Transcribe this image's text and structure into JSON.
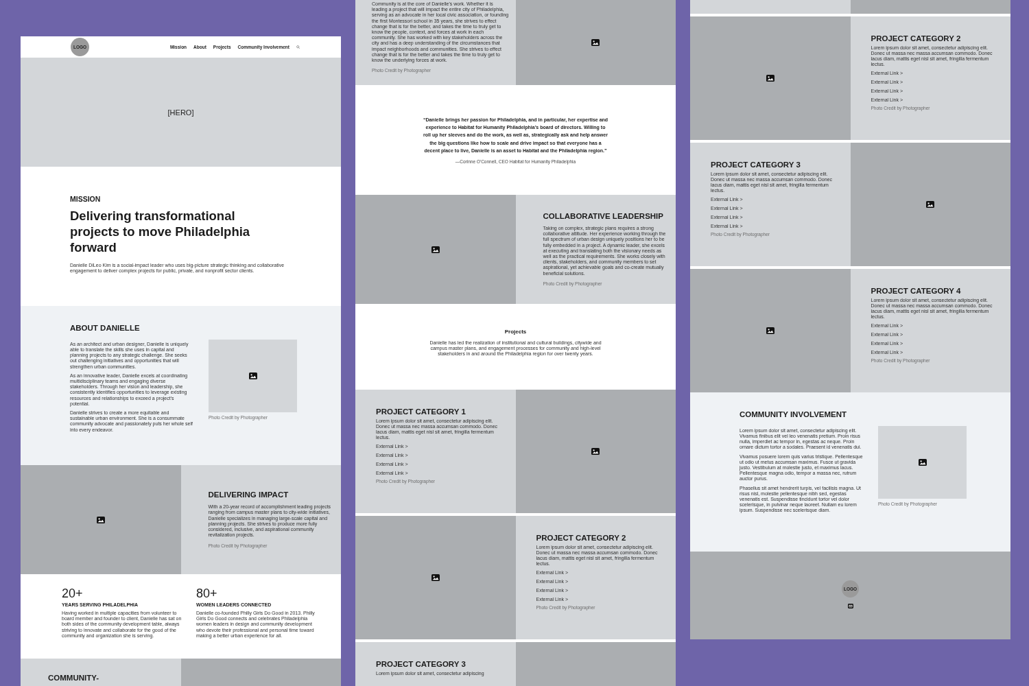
{
  "columns": [
    {
      "sections": [
        {
          "kind": "header",
          "logo": "LOGO",
          "nav": [
            "Mission",
            "About",
            "Projects",
            "Community Involvement"
          ]
        },
        {
          "kind": "hero",
          "label": "[HERO]"
        },
        {
          "kind": "mission",
          "eyebrow": "MISSION",
          "headline": "Delivering transformational projects to move Philadelphia forward",
          "body": "Danielle DiLeo Kim is a social-impact leader who uses big-picture strategic thinking and collaborative engagement to deliver complex projects for public, private, and nonprofit sector clients."
        },
        {
          "kind": "feature",
          "heading": "ABOUT DANIELLE",
          "paragraphs": [
            "As an architect and urban designer, Danielle is uniquely able to translate the skills she uses in capital and planning projects to any strategic challenge. She seeks out challenging initiatives and opportunities that will strengthen urban communities.",
            "As an innovative leader, Danielle excels at coordinating multidisciplinary teams and engaging diverse stakeholders. Through her vision and leadership, she consistently identifies opportunities to leverage existing resources and relationships to exceed a project's potential.",
            "Danielle strives to create a more equitable and sustainable urban environment. She is a consummate community advocate and passionately puts her whole self into every endeavor."
          ],
          "credit": "Photo Credit by Photographer"
        },
        {
          "kind": "split",
          "panels": [
            {
              "kind": "image",
              "icon": true
            },
            {
              "kind": "text",
              "heading": "DELIVERING IMPACT",
              "paragraphs": [
                "With a 20-year record of accomplishment leading projects ranging from campus master plans to city-wide initiatives, Danielle specializes in managing large-scale capital and planning projects. She strives to produce more fully considered, inclusive, and aspirational community revitalization projects."
              ],
              "credit": "Photo Credit by Photographer"
            }
          ]
        },
        {
          "kind": "stats",
          "items": [
            {
              "figure": "20+",
              "label": "YEARS SERVING PHILADELPHIA",
              "text": "Having worked in multiple capacities from volunteer to board member and founder to client, Danielle has sat on both sides of the community development table, always striving to innovate and collaborate for the good of the community and organization she is serving."
            },
            {
              "figure": "80+",
              "label": "WOMEN LEADERS CONNECTED",
              "text": "Danielle co-founded Philly Girls Do Good in 2013. Philly Girls Do Good connects and celebrates Philadelphia women leaders in design and community development who devote their professional and personal time toward making a better urban experience for all."
            }
          ]
        },
        {
          "kind": "split",
          "panels": [
            {
              "kind": "text",
              "heading": "COMMUNITY-"
            },
            {
              "kind": "image"
            }
          ]
        }
      ]
    },
    {
      "sections": [
        {
          "kind": "continued",
          "panels": [
            {
              "kind": "text",
              "paragraphs": [
                "Community is at the core of Danielle's work. Whether it is leading a project that will impact the entire city of Philadelphia, serving as an advocate in her local civic association, or founding the first Montessori school in 35 years, she strives to effect change that is for the better, and takes the time to truly get to know the people, context, and forces at work in each community. She has worked with key stakeholders across the city and has a deep understanding of the circumstances that impact neighborhoods and communities. She strives to effect change that is for the better and takes the time to truly get to know the underlying forces at work."
              ],
              "credit": "Photo Credit by Photographer"
            },
            {
              "kind": "image",
              "icon": true
            }
          ]
        },
        {
          "kind": "quote",
          "quote": "“Danielle brings her passion for Philadelphia, and in particular, her expertise and experience to Habitat for Humanity Philadelphia’s board of directors. Willing to roll up her sleeves and do the work, as well as, strategically ask and help answer the big questions like how to scale and drive impact so that everyone has a decent place to live, Danielle is an asset to Habitat and the Philadelphia region.”",
          "attribution": "—Corinne O'Connell, CEO Habitat for Humanity Philadelphia"
        },
        {
          "kind": "split",
          "panels": [
            {
              "kind": "image",
              "icon": true
            },
            {
              "kind": "text",
              "heading": "COLLABORATIVE LEADERSHIP",
              "paragraphs": [
                "Taking on complex, strategic plans requires a strong collaborative attitude. Her experience working through the full spectrum of urban design uniquely positions her to be fully embedded in a project. A dynamic leader, she excels at executing and translating both the visionary needs as well as the practical requirements. She works closely with clients, stakeholders, and community members to set aspirational, yet achievable goals and co-create mutually beneficial solutions."
              ],
              "credit": "Photo Credit by Photographer"
            }
          ]
        },
        {
          "kind": "intro",
          "heading": "Projects",
          "body": "Danielle has led the realization of institutional and cultural buildings, citywide and campus master plans, and engagement processes for community and high-level stakeholders in and around the Philadelphia region for over twenty years."
        },
        {
          "kind": "category",
          "panels": [
            {
              "kind": "text",
              "heading": "PROJECT CATEGORY 1",
              "paragraphs": [
                "Lorem ipsum dolor sit amet, consectetur adipiscing elit. Donec ut massa nec massa accumsan commodo. Donec lacus diam, mattis eget nisl sit amet, fringilla fermentum lectus."
              ],
              "links": [
                "External Link >",
                "External Link >",
                "External Link >",
                "External Link >"
              ],
              "credit": "Photo Credit by Photographer"
            },
            {
              "kind": "image",
              "icon": true
            }
          ]
        },
        {
          "kind": "category",
          "panels": [
            {
              "kind": "image",
              "icon": true
            },
            {
              "kind": "text",
              "heading": "PROJECT CATEGORY 2",
              "paragraphs": [
                "Lorem ipsum dolor sit amet, consectetur adipiscing elit. Donec ut massa nec massa accumsan commodo. Donec lacus diam, mattis eget nisl sit amet, fringilla fermentum lectus."
              ],
              "links": [
                "External Link >",
                "External Link >",
                "External Link >",
                "External Link >"
              ],
              "credit": "Photo Credit by Photographer"
            }
          ]
        },
        {
          "kind": "category",
          "panels": [
            {
              "kind": "text",
              "heading": "PROJECT CATEGORY 3",
              "paragraphs": [
                "Lorem ipsum dolor sit amet, consectetur adipiscing"
              ]
            },
            {
              "kind": "image"
            }
          ]
        }
      ]
    },
    {
      "sections": [
        {
          "kind": "strip",
          "panels": [
            {
              "kind": "text"
            },
            {
              "kind": "image"
            }
          ]
        },
        {
          "kind": "category",
          "panels": [
            {
              "kind": "image",
              "icon": true
            },
            {
              "kind": "text",
              "heading": "PROJECT CATEGORY 2",
              "paragraphs": [
                "Lorem ipsum dolor sit amet, consectetur adipiscing elit. Donec ut massa nec massa accumsan commodo. Donec lacus diam, mattis eget nisl sit amet, fringilla fermentum lectus."
              ],
              "links": [
                "External Link >",
                "External Link >",
                "External Link >",
                "External Link >"
              ],
              "credit": "Photo Credit by Photographer"
            }
          ]
        },
        {
          "kind": "category",
          "panels": [
            {
              "kind": "text",
              "heading": "PROJECT CATEGORY 3",
              "paragraphs": [
                "Lorem ipsum dolor sit amet, consectetur adipiscing elit. Donec ut massa nec massa accumsan commodo. Donec lacus diam, mattis eget nisl sit amet, fringilla fermentum lectus."
              ],
              "links": [
                "External Link >",
                "External Link >",
                "External Link >",
                "External Link >"
              ],
              "credit": "Photo Credit by Photographer"
            },
            {
              "kind": "image",
              "icon": true
            }
          ]
        },
        {
          "kind": "category",
          "panels": [
            {
              "kind": "image",
              "icon": true
            },
            {
              "kind": "text",
              "heading": "PROJECT CATEGORY 4",
              "paragraphs": [
                "Lorem ipsum dolor sit amet, consectetur adipiscing elit. Donec ut massa nec massa accumsan commodo. Donec lacus diam, mattis eget nisl sit amet, fringilla fermentum lectus."
              ],
              "links": [
                "External Link >",
                "External Link >",
                "External Link >",
                "External Link >"
              ],
              "credit": "Photo Credit by Photographer"
            }
          ]
        },
        {
          "kind": "feature",
          "heading": "COMMUNITY INVOLVEMENT",
          "paragraphs": [
            "Lorem ipsum dolor sit amet, consectetur adipiscing elit. Vivamus finibus elit vel leo venenatis pretium. Proin risus nulla, imperdiet ac tempor in, egestas ac neque. Proin ornare dictum tortor a sodales. Praesent id venenatis dui.",
            "Vivamus posuere lorem quis varius tristique. Pellentesque ut odio ut metus accumsan maximus. Fusce ut gravida justo. Vestibulum at molestie justo, et maximus lacus. Pellentesque magna odio, tempor a massa nec, rutrum auctor purus.",
            "Phasellus sit amet hendrerit turpis, vel facilisis magna. Ut risus nisl, molestie pellentesque nibh sed, egestas venenatis est. Suspendisse tincidunt tortor vel dolor scelerisque, in pulvinar neque laoreet. Nullam eu lorem ipsum. Suspendisse nec scelerisque diam."
          ],
          "credit": "Photo Credit by Photographer"
        },
        {
          "kind": "footer",
          "logo": "LOGO"
        }
      ]
    }
  ]
}
